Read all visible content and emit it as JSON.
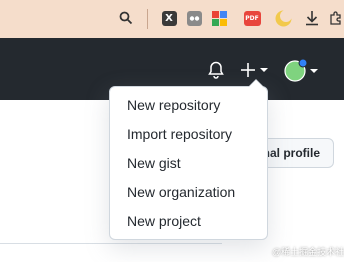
{
  "browser": {
    "extensions": [
      {
        "name": "search"
      },
      {
        "name": "x-extension",
        "glyph": "X",
        "color": "#3a3a3a"
      },
      {
        "name": "gray-extension",
        "color": "#7a7a7a"
      },
      {
        "name": "grid-extension",
        "colors": [
          "#ea4335",
          "#4285f4",
          "#34a853",
          "#fbbc05"
        ]
      },
      {
        "name": "pdf-extension",
        "glyph": "PDF",
        "color": "#e8453c"
      },
      {
        "name": "moon-extension",
        "color": "#f2c94c"
      },
      {
        "name": "download"
      },
      {
        "name": "puzzle"
      }
    ]
  },
  "header": {
    "bg_color": "#24292f",
    "icons": [
      "bell-icon",
      "plus-icon",
      "avatar"
    ],
    "avatar_color": "#7fd37f",
    "badge_color": "#2f81f7"
  },
  "dropdown": {
    "items": [
      {
        "label": "New repository"
      },
      {
        "label": "Import repository"
      },
      {
        "label": "New gist"
      },
      {
        "label": "New organization"
      },
      {
        "label": "New project"
      }
    ]
  },
  "content": {
    "partial_button_label": "nal profile"
  },
  "watermark": "@稀土掘金技术社区"
}
